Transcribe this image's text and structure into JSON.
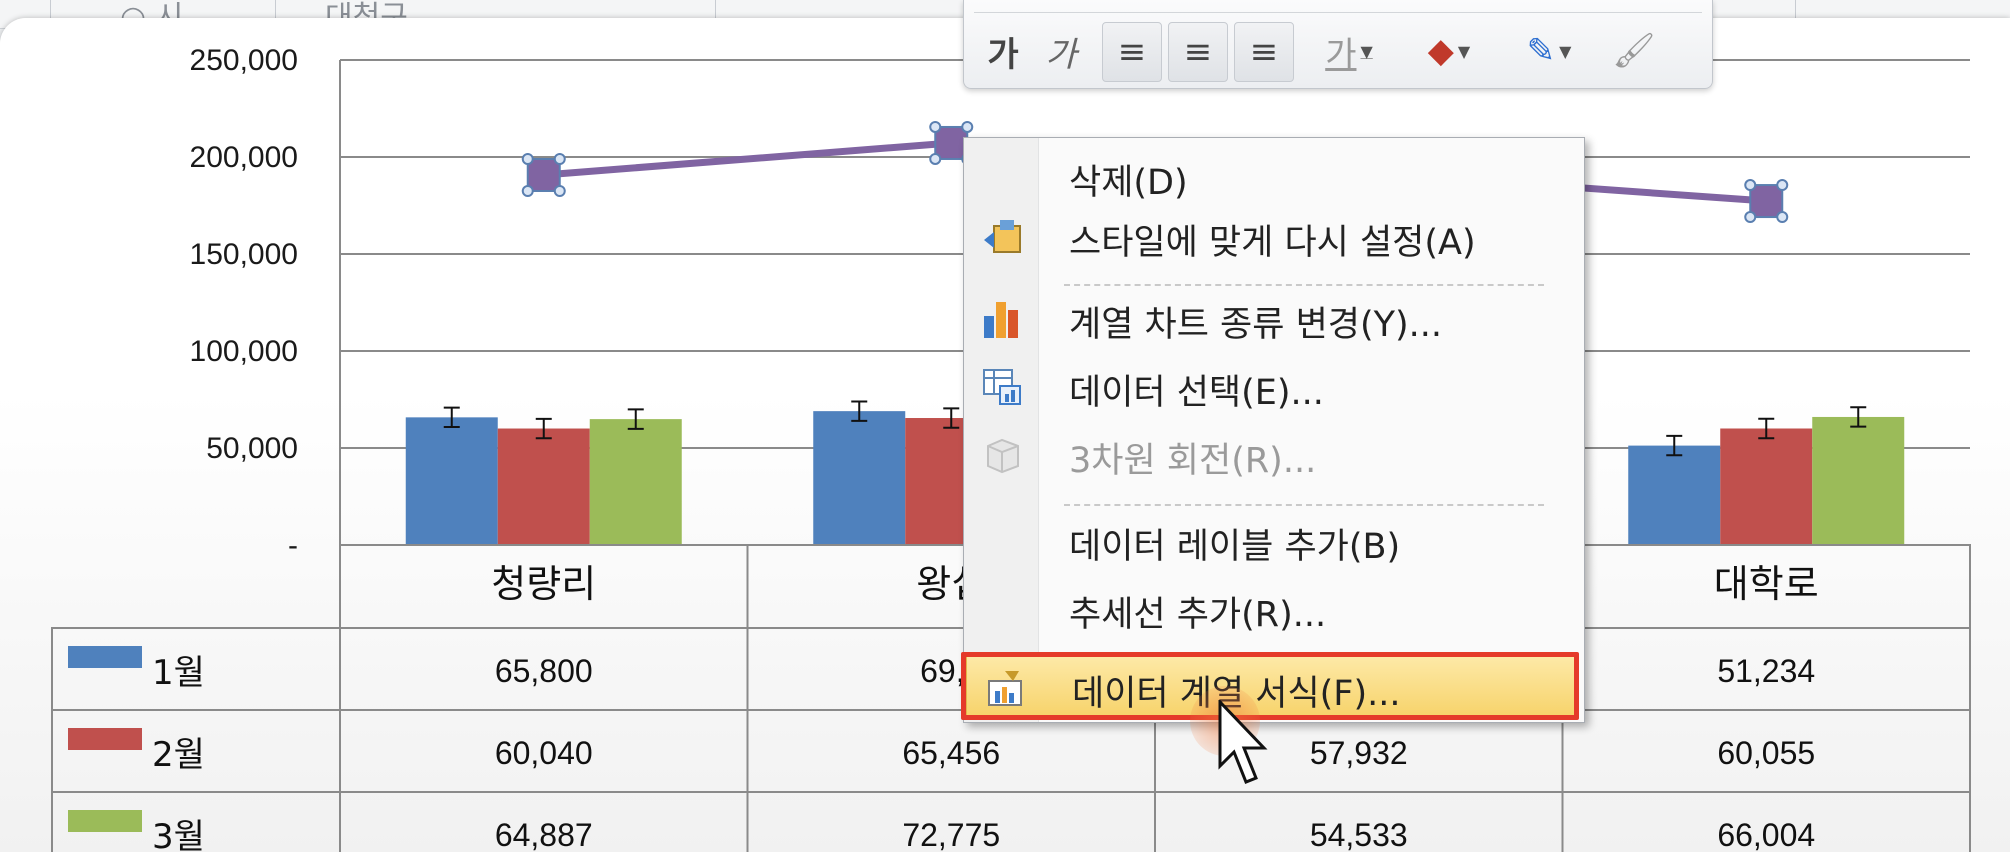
{
  "sheet_strip": {
    "partial_texts": [
      "○ 시",
      "대청구"
    ]
  },
  "mini_toolbar": {
    "buttons": [
      {
        "name": "bold-button",
        "glyph": "가"
      },
      {
        "name": "italic-button",
        "glyph": "가"
      },
      {
        "name": "align-left-button",
        "glyph": "≡"
      },
      {
        "name": "align-center-button",
        "glyph": "≡"
      },
      {
        "name": "align-right-button",
        "glyph": "≡"
      },
      {
        "name": "font-color-button",
        "glyph": "가"
      },
      {
        "name": "fill-color-button",
        "glyph": "◆"
      },
      {
        "name": "outline-color-button",
        "glyph": "✎"
      },
      {
        "name": "format-painter-button",
        "glyph": "🖌"
      }
    ],
    "colors": {
      "fill": "#c0392b",
      "outline": "#2e6fd1",
      "font": "#9a9a9a"
    }
  },
  "context_menu": {
    "items": [
      {
        "label": "삭제(D)",
        "icon": "none",
        "enabled": true
      },
      {
        "label": "스타일에 맞게 다시 설정(A)",
        "icon": "reset-style-icon",
        "enabled": true
      },
      {
        "label": "계열 차트 종류 변경(Y)...",
        "icon": "bar-chart-icon",
        "enabled": true
      },
      {
        "label": "데이터 선택(E)...",
        "icon": "select-data-icon",
        "enabled": true
      },
      {
        "label": "3차원 회전(R)...",
        "icon": "cube-icon",
        "enabled": false
      },
      {
        "label": "데이터 레이블 추가(B)",
        "icon": "none",
        "enabled": true
      },
      {
        "label": "추세선 추가(R)...",
        "icon": "none",
        "enabled": true
      },
      {
        "label": "데이터 계열 서식(F)...",
        "icon": "format-series-icon",
        "enabled": true,
        "highlighted": true
      }
    ]
  },
  "chart_data": {
    "type": "bar",
    "y_ticks": [
      "250,000",
      "200,000",
      "150,000",
      "100,000",
      "50,000",
      "-"
    ],
    "ylim": [
      0,
      250000
    ],
    "categories": [
      "청량리",
      "왕십",
      "",
      "대학로"
    ],
    "series": [
      {
        "name": "1월",
        "color": "#4f81bd",
        "values": [
          65800,
          69000,
          null,
          51234
        ],
        "table_values": [
          "65,800",
          "69,0",
          "",
          "51,234"
        ]
      },
      {
        "name": "2월",
        "color": "#c0504d",
        "values": [
          60040,
          65456,
          57932,
          60055
        ],
        "table_values": [
          "60,040",
          "65,456",
          "57,932",
          "60,055"
        ]
      },
      {
        "name": "3월",
        "color": "#9bbb59",
        "values": [
          64887,
          72775,
          54533,
          66004
        ],
        "table_values": [
          "64,887",
          "72,775",
          "54,533",
          "66,004"
        ]
      }
    ],
    "line_series": {
      "color": "#8064a2",
      "values": [
        190727,
        207231,
        null,
        177293
      ]
    },
    "data_table": true,
    "error_bars": true
  }
}
